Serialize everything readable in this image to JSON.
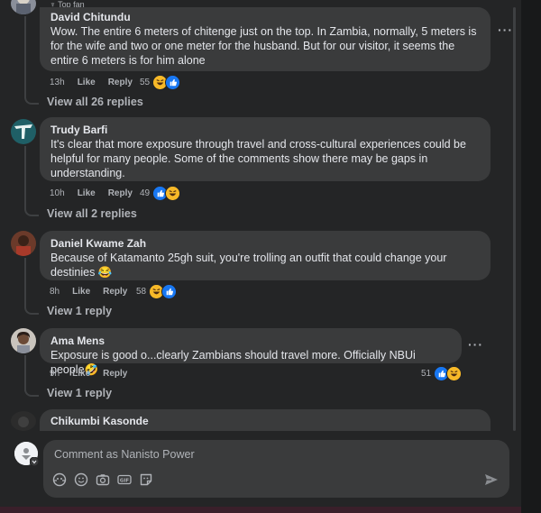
{
  "top_label": "Top fan",
  "comments": [
    {
      "name": "David Chitundu",
      "text_lines": [
        "Wow. The entire 6 meters of chitenge just on the top. In Zambia, normally, 5 meters is",
        "for the wife and two or one meter for the husband. But for our visitor, it seems the",
        "entire 6 meters is for him alone"
      ],
      "time": "13h",
      "like": "Like",
      "reply": "Reply",
      "reactions": "55",
      "view_replies": "View all 26 replies"
    },
    {
      "name": "Trudy Barfi",
      "text_lines": [
        "It's clear that more exposure through travel and cross-cultural experiences could be",
        "helpful for many people. Some of the comments show there may be gaps in",
        "understanding."
      ],
      "time": "10h",
      "like": "Like",
      "reply": "Reply",
      "reactions": "49",
      "view_replies": "View all 2 replies"
    },
    {
      "name": "Daniel Kwame Zah",
      "text_lines": [
        "Because of Katamanto 25gh suit, you're trolling an outfit that could change your",
        "destinies 😂"
      ],
      "time": "8h",
      "like": "Like",
      "reply": "Reply",
      "reactions": "58",
      "view_replies": "View 1 reply"
    },
    {
      "name": "Ama Mens",
      "text_lines": [
        "Exposure is good o...clearly Zambians should travel more. Officially NBUi people🤣"
      ],
      "time": "9h",
      "like": "Like",
      "reply": "Reply",
      "reactions": "51",
      "view_replies": "View 1 reply"
    },
    {
      "name": "Chikumbi Kasonde"
    }
  ],
  "composer": {
    "placeholder": "Comment as Nanisto Power"
  },
  "colors": {
    "background": "#242526",
    "bubble": "#3a3b3c",
    "like": "#1877f2",
    "haha": "#f7b928"
  }
}
